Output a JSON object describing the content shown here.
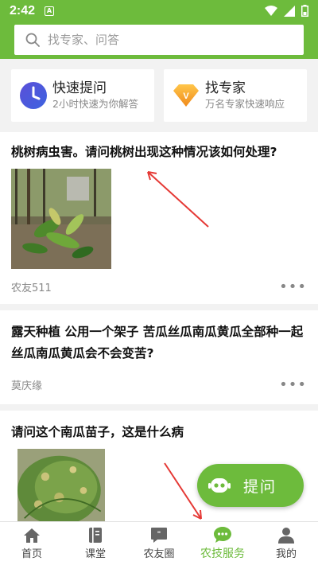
{
  "status": {
    "time": "2:42",
    "notif_letter": "A"
  },
  "search": {
    "placeholder": "找专家、问答"
  },
  "quick": [
    {
      "title": "快速提问",
      "subtitle": "2小时快速为你解答",
      "icon": "clock-icon"
    },
    {
      "title": "找专家",
      "subtitle": "万名专家快速响应",
      "icon": "diamond-v-icon",
      "icon_letter": "V"
    }
  ],
  "posts": [
    {
      "title": "桃树病虫害。请问桃树出现这种情况该如何处理?",
      "author": "农友511",
      "more": "•••"
    },
    {
      "title": "露天种植 公用一个架子 苦瓜丝瓜南瓜黄瓜全部种一起丝瓜南瓜黄瓜会不会变苦?",
      "author": "莫庆缘",
      "more": "•••"
    },
    {
      "title": "请问这个南瓜苗子，这是什么病"
    }
  ],
  "fab": {
    "label": "提问"
  },
  "nav": [
    {
      "label": "首页",
      "icon": "home-icon"
    },
    {
      "label": "课堂",
      "icon": "book-icon"
    },
    {
      "label": "农友圈",
      "icon": "chat-quote-icon"
    },
    {
      "label": "农技服务",
      "icon": "chat-dots-icon",
      "active": true
    },
    {
      "label": "我的",
      "icon": "person-icon"
    }
  ],
  "colors": {
    "brand": "#6dbb3c",
    "annotation": "#e53935"
  }
}
